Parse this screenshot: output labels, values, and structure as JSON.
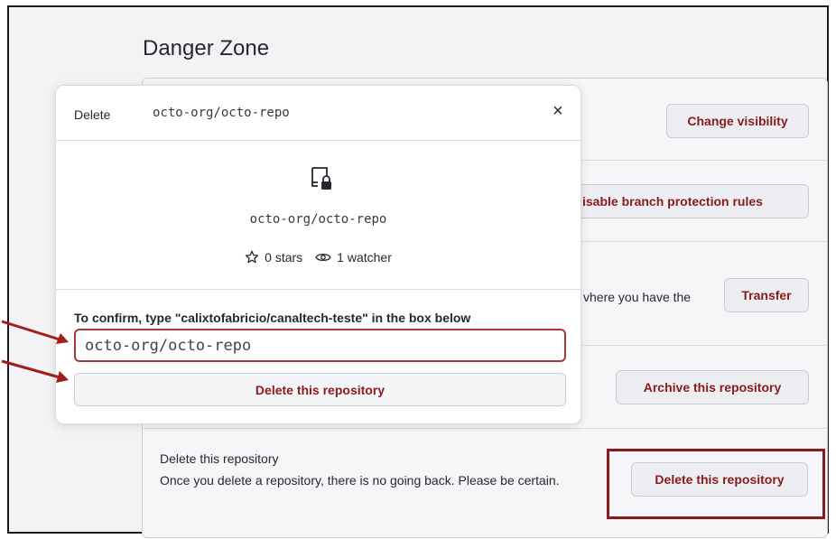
{
  "page": {
    "title": "Danger Zone"
  },
  "sections": {
    "change_visibility": {
      "button": "Change visibility"
    },
    "branch_protection": {
      "button": "isable branch protection rules"
    },
    "transfer": {
      "text_partial": "vhere you have the",
      "button": "Transfer"
    },
    "archive": {
      "button": "Archive this repository"
    },
    "delete": {
      "title": "Delete this repository",
      "description": "Once you delete a repository, there is no going back. Please be certain.",
      "button": "Delete this repository"
    }
  },
  "modal": {
    "header_label": "Delete",
    "header_repo": "octo-org/octo-repo",
    "close_label": "×",
    "repo_icon": "repo-locked-icon",
    "repo_name": "octo-org/octo-repo",
    "stars": "0 stars",
    "watchers": "1 watcher",
    "confirm_text": "To confirm, type \"calixtofabricio/canaltech-teste\" in the box below",
    "input_value": "octo-org/octo-repo",
    "delete_button": "Delete this repository"
  },
  "colors": {
    "danger": "#8b1a1a",
    "annotation": "#a31c1c",
    "border": "#e3c7c7"
  }
}
